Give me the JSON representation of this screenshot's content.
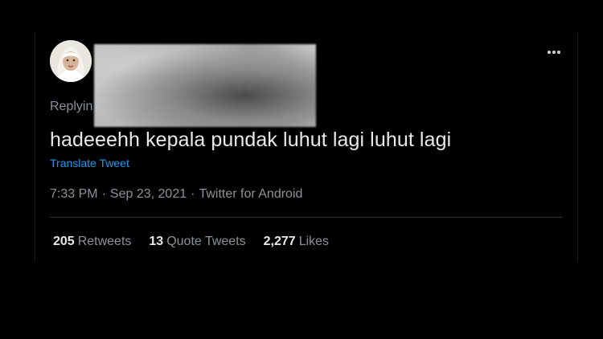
{
  "tweet": {
    "replying_prefix": "Replyin",
    "text": "hadeeehh kepala pundak luhut lagi luhut lagi",
    "translate_label": "Translate Tweet",
    "time": "7:33 PM",
    "date": "Sep 23, 2021",
    "source": "Twitter for Android",
    "separator": "·",
    "avatar_icon": "user-avatar"
  },
  "stats": {
    "retweets_count": "205",
    "retweets_label": "Retweets",
    "quotes_count": "13",
    "quotes_label": "Quote Tweets",
    "likes_count": "2,277",
    "likes_label": "Likes"
  },
  "icons": {
    "more": "more-horizontal-icon"
  },
  "colors": {
    "background": "#000000",
    "text_primary": "#e7e9ea",
    "text_secondary": "#8b9299",
    "link": "#1d9bf0",
    "divider": "#2f3336"
  }
}
